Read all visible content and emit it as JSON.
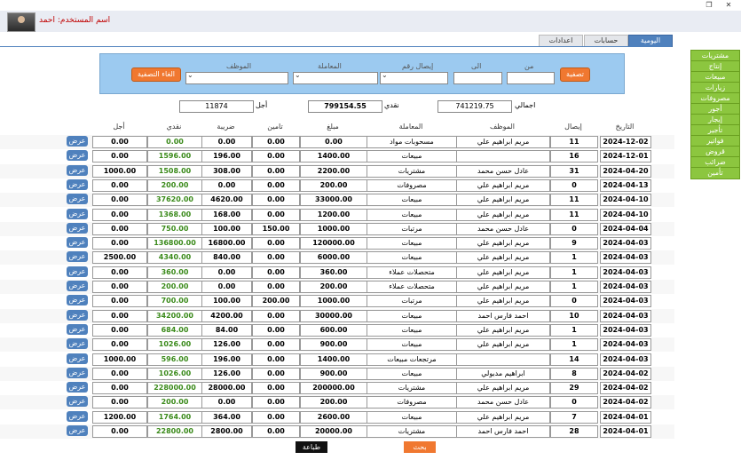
{
  "window": {
    "restore_icon": "restore-icon",
    "close_icon": "close-icon"
  },
  "header": {
    "username_label": "اسم المستخدم: احمد"
  },
  "tabs": [
    {
      "label": "اليومية",
      "active": true
    },
    {
      "label": "حسابات",
      "active": false
    },
    {
      "label": "اعدادات",
      "active": false
    }
  ],
  "sidebar": [
    "مشتريات",
    "إنتاج",
    "مبيعات",
    "زيارات",
    "مصروفات",
    "أجور",
    "إيجار",
    "تأجير",
    "فواتير",
    "قروض",
    "ضرائب",
    "تأمين"
  ],
  "filter": {
    "from_label": "من",
    "to_label": "الى",
    "receipt_label": "إيصال رقم",
    "transaction_label": "المعاملة",
    "employee_label": "الموظف",
    "filter_button": "تصفية",
    "clear_button": "الغاء التصفية"
  },
  "summary": {
    "total_label": "اجمالي",
    "total_value": "741219.75",
    "cash_label": "نقدي",
    "cash_value": "799154.55",
    "credit_label": "أجل",
    "credit_value": "11874"
  },
  "columns": [
    "التاريخ",
    "إيصال",
    "الموظف",
    "المعاملة",
    "مبلغ",
    "تامين",
    "ضريبة",
    "نقدي",
    "أجل"
  ],
  "rows": [
    {
      "date": "2024-12-02",
      "receipt": "11",
      "employee": "مريم ابراهيم علي",
      "transaction": "مسحوبات مواد",
      "amount": "0.00",
      "insurance": "0.00",
      "tax": "0.00",
      "cash": "0.00",
      "credit": "0.00"
    },
    {
      "date": "2024-12-01",
      "receipt": "16",
      "employee": "",
      "transaction": "مبيعات",
      "amount": "1400.00",
      "insurance": "0.00",
      "tax": "196.00",
      "cash": "1596.00",
      "credit": "0.00"
    },
    {
      "date": "2024-04-20",
      "receipt": "31",
      "employee": "عادل حسن محمد",
      "transaction": "مشتريات",
      "amount": "2200.00",
      "insurance": "0.00",
      "tax": "308.00",
      "cash": "1508.00",
      "credit": "1000.00"
    },
    {
      "date": "2024-04-13",
      "receipt": "0",
      "employee": "مريم ابراهيم علي",
      "transaction": "مصروفات",
      "amount": "200.00",
      "insurance": "0.00",
      "tax": "0.00",
      "cash": "200.00",
      "credit": "0.00"
    },
    {
      "date": "2024-04-10",
      "receipt": "11",
      "employee": "مريم ابراهيم علي",
      "transaction": "مبيعات",
      "amount": "33000.00",
      "insurance": "0.00",
      "tax": "4620.00",
      "cash": "37620.00",
      "credit": "0.00"
    },
    {
      "date": "2024-04-10",
      "receipt": "11",
      "employee": "مريم ابراهيم علي",
      "transaction": "مبيعات",
      "amount": "1200.00",
      "insurance": "0.00",
      "tax": "168.00",
      "cash": "1368.00",
      "credit": "0.00"
    },
    {
      "date": "2024-04-04",
      "receipt": "0",
      "employee": "عادل حسن محمد",
      "transaction": "مرتبات",
      "amount": "1000.00",
      "insurance": "150.00",
      "tax": "100.00",
      "cash": "750.00",
      "credit": "0.00"
    },
    {
      "date": "2024-04-03",
      "receipt": "9",
      "employee": "مريم ابراهيم علي",
      "transaction": "مبيعات",
      "amount": "120000.00",
      "insurance": "0.00",
      "tax": "16800.00",
      "cash": "136800.00",
      "credit": "0.00"
    },
    {
      "date": "2024-04-03",
      "receipt": "1",
      "employee": "مريم ابراهيم علي",
      "transaction": "مبيعات",
      "amount": "6000.00",
      "insurance": "0.00",
      "tax": "840.00",
      "cash": "4340.00",
      "credit": "2500.00"
    },
    {
      "date": "2024-04-03",
      "receipt": "1",
      "employee": "مريم ابراهيم علي",
      "transaction": "متحصلات عملاء",
      "amount": "360.00",
      "insurance": "0.00",
      "tax": "0.00",
      "cash": "360.00",
      "credit": "0.00"
    },
    {
      "date": "2024-04-03",
      "receipt": "1",
      "employee": "مريم ابراهيم علي",
      "transaction": "متحصلات عملاء",
      "amount": "200.00",
      "insurance": "0.00",
      "tax": "0.00",
      "cash": "200.00",
      "credit": "0.00"
    },
    {
      "date": "2024-04-03",
      "receipt": "0",
      "employee": "مريم ابراهيم علي",
      "transaction": "مرتبات",
      "amount": "1000.00",
      "insurance": "200.00",
      "tax": "100.00",
      "cash": "700.00",
      "credit": "0.00"
    },
    {
      "date": "2024-04-03",
      "receipt": "10",
      "employee": "احمد فارس احمد",
      "transaction": "مبيعات",
      "amount": "30000.00",
      "insurance": "0.00",
      "tax": "4200.00",
      "cash": "34200.00",
      "credit": "0.00"
    },
    {
      "date": "2024-04-03",
      "receipt": "1",
      "employee": "مريم ابراهيم علي",
      "transaction": "مبيعات",
      "amount": "600.00",
      "insurance": "0.00",
      "tax": "84.00",
      "cash": "684.00",
      "credit": "0.00"
    },
    {
      "date": "2024-04-03",
      "receipt": "1",
      "employee": "مريم ابراهيم علي",
      "transaction": "مبيعات",
      "amount": "900.00",
      "insurance": "0.00",
      "tax": "126.00",
      "cash": "1026.00",
      "credit": "0.00"
    },
    {
      "date": "2024-04-03",
      "receipt": "14",
      "employee": "",
      "transaction": "مرتجعات مبيعات",
      "amount": "1400.00",
      "insurance": "0.00",
      "tax": "196.00",
      "cash": "596.00",
      "credit": "1000.00"
    },
    {
      "date": "2024-04-02",
      "receipt": "8",
      "employee": "ابراهيم مدبولي",
      "transaction": "مبيعات",
      "amount": "900.00",
      "insurance": "0.00",
      "tax": "126.00",
      "cash": "1026.00",
      "credit": "0.00"
    },
    {
      "date": "2024-04-02",
      "receipt": "29",
      "employee": "مريم ابراهيم علي",
      "transaction": "مشتريات",
      "amount": "200000.00",
      "insurance": "0.00",
      "tax": "28000.00",
      "cash": "228000.00",
      "credit": "0.00"
    },
    {
      "date": "2024-04-02",
      "receipt": "0",
      "employee": "عادل حسن محمد",
      "transaction": "مصروفات",
      "amount": "200.00",
      "insurance": "0.00",
      "tax": "0.00",
      "cash": "200.00",
      "credit": "0.00"
    },
    {
      "date": "2024-04-01",
      "receipt": "7",
      "employee": "مريم ابراهيم علي",
      "transaction": "مبيعات",
      "amount": "2600.00",
      "insurance": "0.00",
      "tax": "364.00",
      "cash": "1764.00",
      "credit": "1200.00"
    },
    {
      "date": "2024-04-01",
      "receipt": "28",
      "employee": "احمد فارس احمد",
      "transaction": "مشتريات",
      "amount": "20000.00",
      "insurance": "0.00",
      "tax": "2800.00",
      "cash": "22800.00",
      "credit": "0.00"
    }
  ],
  "row_button": "عرض",
  "footer": {
    "print_button": "طباعة",
    "search_button": "بحث"
  },
  "colors": {
    "accent_blue": "#4f81bd",
    "side_green": "#8cc63f",
    "orange": "#f07830",
    "filter_bg": "#9ccaf0",
    "cash_green": "#3a8a1a"
  }
}
